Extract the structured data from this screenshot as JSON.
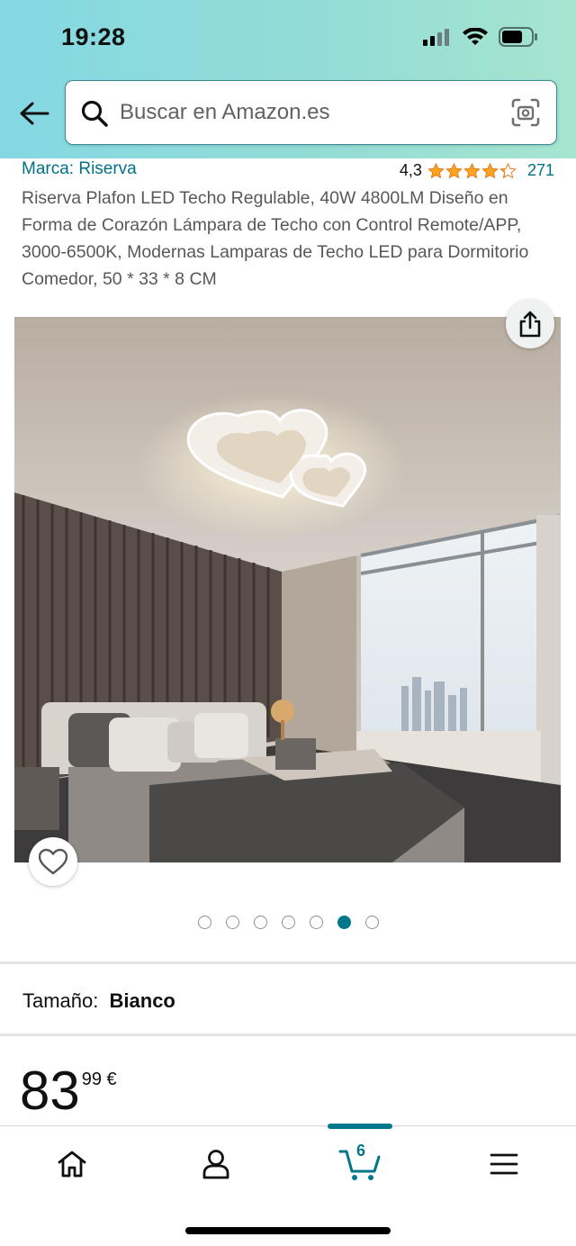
{
  "status_bar": {
    "time": "19:28"
  },
  "search": {
    "placeholder": "Buscar en Amazon.es"
  },
  "product": {
    "brand": "Marca: Riserva",
    "rating_value": "4,3",
    "rating_stars": 4.3,
    "rating_count": "271",
    "title": "Riserva Plafon LED Techo Regulable, 40W 4800LM Diseño en Forma de Corazón Lámpara de Techo con Control Remote/APP, 3000-6500K, Modernas Lamparas de Techo LED para Dormitorio Comedor, 50 * 33 * 8 CM",
    "image_count": 7,
    "active_image_index": 5
  },
  "size": {
    "label": "Tamaño:",
    "value": "Bianco"
  },
  "price": {
    "whole": "83",
    "fraction": "99 €"
  },
  "cart": {
    "count": "6"
  },
  "colors": {
    "accent": "#007185",
    "header_gradient_start": "#84d8e3",
    "header_gradient_end": "#a6e5cf",
    "star": "#ffa41c"
  },
  "icons": {
    "back": "arrow-left-icon",
    "search": "search-icon",
    "camera": "camera-scan-icon",
    "share": "share-icon",
    "wishlist": "heart-icon",
    "home": "home-icon",
    "account": "person-icon",
    "cart": "cart-icon",
    "menu": "menu-icon"
  }
}
